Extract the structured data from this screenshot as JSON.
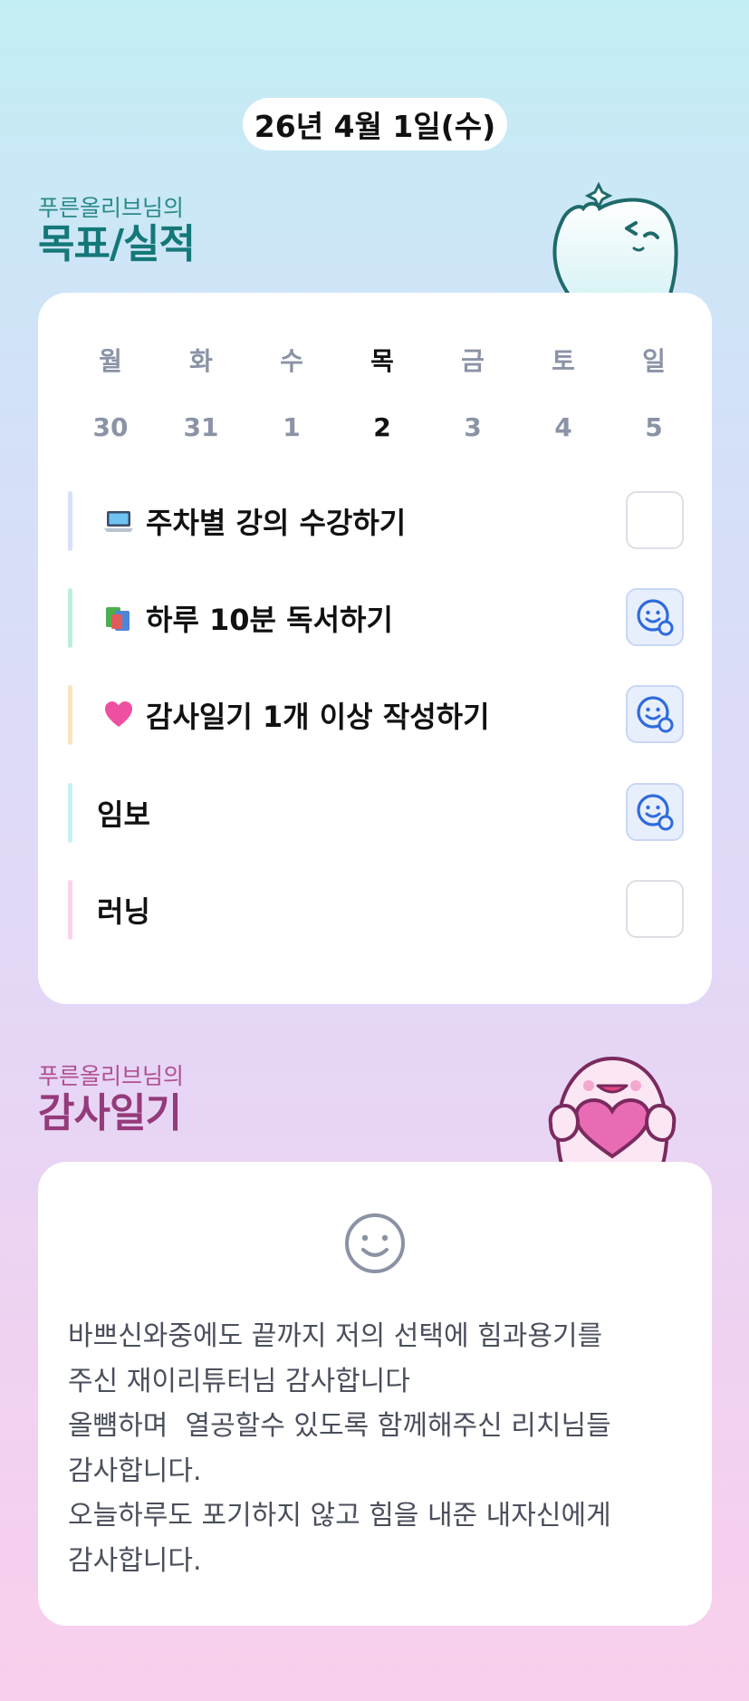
{
  "header": {
    "date": "26년 4월 1일(수)"
  },
  "goals_section": {
    "subtitle": "푸른올리브님의",
    "title": "목표/실적",
    "week": {
      "days": [
        "월",
        "화",
        "수",
        "목",
        "금",
        "토",
        "일"
      ],
      "dates": [
        "30",
        "31",
        "1",
        "2",
        "3",
        "4",
        "5"
      ],
      "today_index": 3
    },
    "items": [
      {
        "icon": "laptop-icon",
        "label": "주차별 강의 수강하기",
        "bar_color": "#d6e0fb",
        "checked": false
      },
      {
        "icon": "books-icon",
        "label": "하루 10분 독서하기",
        "bar_color": "#bdeedd",
        "checked": true
      },
      {
        "icon": "heart-icon",
        "label": "감사일기 1개 이상 작성하기",
        "bar_color": "#fbe3bd",
        "checked": true
      },
      {
        "icon": "",
        "label": "임보",
        "bar_color": "#c6f1f3",
        "checked": true
      },
      {
        "icon": "",
        "label": "러닝",
        "bar_color": "#fbd3ec",
        "checked": false
      }
    ]
  },
  "diary_section": {
    "subtitle": "푸른올리브님의",
    "title": "감사일기",
    "mood_icon": "smile-face-icon",
    "lines": [
      "바쁘신와중에도 끝까지 저의 선택에 힘과용기를",
      "주신 재이리튜터님 감사합니다",
      "올뻄하며  열공할수 있도록 함께해주신 리치님들",
      "감사합니다.",
      "오늘하루도 포기하지 않고 힘을 내준 내자신에게",
      "감사합니다."
    ]
  },
  "colors": {
    "goals_title": "#157878",
    "diary_title": "#953a7a",
    "check_done_bg": "#e8effc",
    "check_icon": "#2f6bdc"
  }
}
